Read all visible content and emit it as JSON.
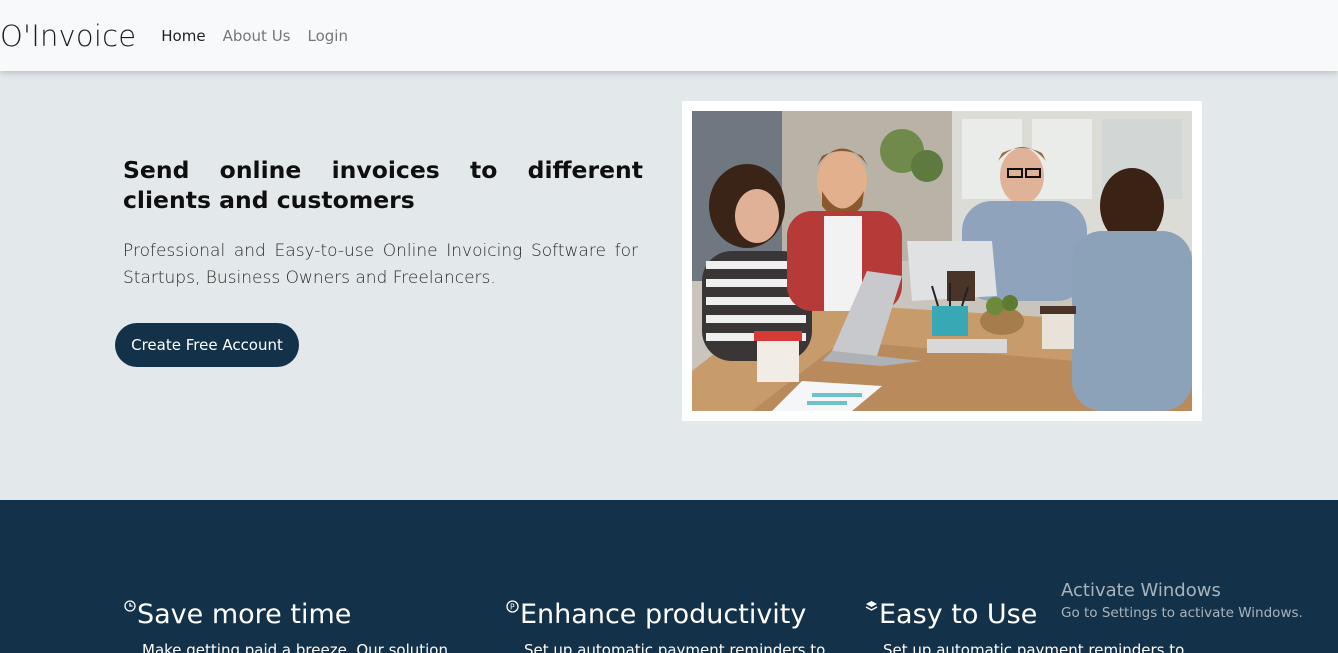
{
  "navbar": {
    "brand": "O'Invoice",
    "links": [
      {
        "label": "Home",
        "active": true
      },
      {
        "label": "About Us",
        "active": false
      },
      {
        "label": "Login",
        "active": false
      }
    ]
  },
  "hero": {
    "title": "Send online invoices to different clients and customers",
    "subtitle": "Professional and Easy-to-use Online Invoicing Software for Startups, Business Owners and Freelancers.",
    "cta_label": "Create Free Account",
    "image_alt": "team-meeting-photo"
  },
  "features": [
    {
      "icon": "clock-icon",
      "title": "Save more time",
      "desc": "Make getting paid a breeze. Our solution"
    },
    {
      "icon": "productivity-icon",
      "title": "Enhance productivity",
      "desc": "Set up automatic payment reminders to"
    },
    {
      "icon": "layers-icon",
      "title": "Easy to Use",
      "desc": "Set up automatic payment reminders to"
    }
  ],
  "watermark": {
    "title": "Activate Windows",
    "subtitle": "Go to Settings to activate Windows."
  },
  "colors": {
    "navy": "#13324a",
    "hero_bg": "#e3e8eb",
    "navbar_bg": "#f8f9fa"
  }
}
